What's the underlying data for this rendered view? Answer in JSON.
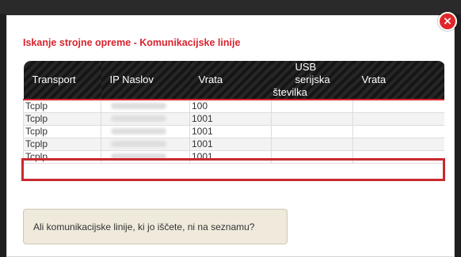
{
  "dialog": {
    "title": "Iskanje strojne opreme - Komunikacijske linije",
    "close_icon": "×"
  },
  "table": {
    "headers": {
      "transport": "Transport",
      "ip": "IP Naslov",
      "port": "Vrata",
      "usb_line1": "USB serijska",
      "usb_line2": "številka",
      "port2": "Vrata"
    },
    "rows": [
      {
        "transport": "Tcplp",
        "port": "100"
      },
      {
        "transport": "Tcplp",
        "port": "1001"
      },
      {
        "transport": "Tcplp",
        "port": "1001"
      },
      {
        "transport": "Tcplp",
        "port": "1001"
      },
      {
        "transport": "Tcplp",
        "port": "1001"
      }
    ]
  },
  "notice_button": {
    "label": "Ali komunikacijske linije, ki jo iščete, ni na seznamu?"
  },
  "colors": {
    "accent": "#d9232e",
    "highlight": "#c72a30",
    "header_bg": "#1d1d1d",
    "notice_bg": "#efeadc"
  }
}
